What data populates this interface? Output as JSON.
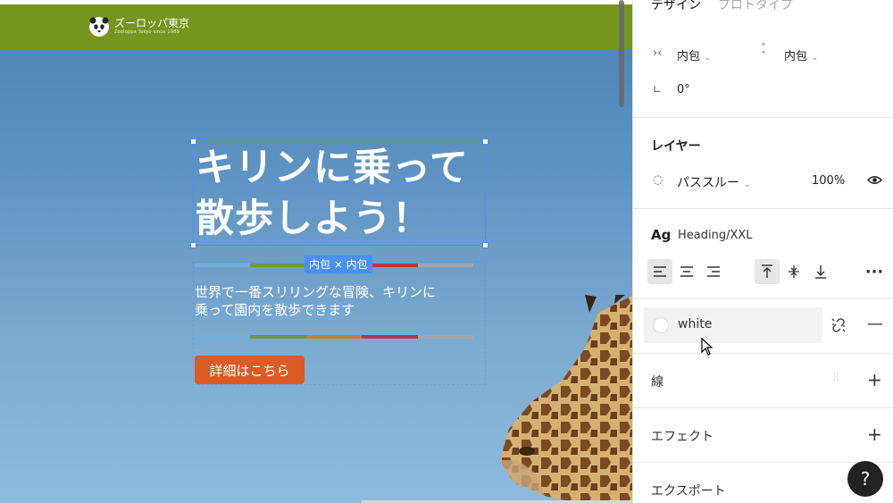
{
  "site": {
    "logo_title": "ズーロッパ東京",
    "logo_sub": "Zooloppa Tokyo since 1989",
    "heading": "キリンに乗って\n散歩しよう！",
    "body": "世界で一番スリリングな冒険、キリンに\n乗って園内を散歩できます",
    "cta": "詳細はこちら",
    "size_badge": "内包 × 内包",
    "stripe_colors": [
      "#6fb0d8",
      "#6e9a3a",
      "#d07a2e",
      "#b23c3c",
      "#a6a6a6"
    ],
    "header_color": "#76951f",
    "cta_color": "#dc5b25"
  },
  "panel": {
    "tabs": [
      "デザイン",
      "プロトタイプ"
    ],
    "resizing": {
      "horizontal_icon": "hug-horizontal-icon",
      "horizontal": "内包",
      "vertical_icon": "hug-vertical-icon",
      "vertical": "内包",
      "rotation": "0°"
    },
    "layer": {
      "title": "レイヤー",
      "blend": "パススルー",
      "opacity": "100%"
    },
    "text": {
      "ag": "Ag",
      "style": "Heading/XXL"
    },
    "fill": {
      "name": "white",
      "color": "#ffffff"
    },
    "stroke": {
      "title": "線"
    },
    "effect": {
      "title": "エフェクト"
    },
    "export": {
      "title": "エクスポート"
    },
    "help": "?"
  }
}
